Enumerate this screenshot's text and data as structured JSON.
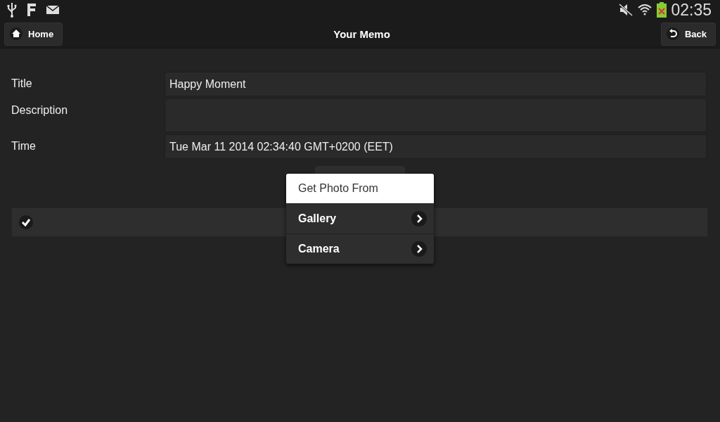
{
  "status_bar": {
    "time": "02:35"
  },
  "header": {
    "title": "Your Memo",
    "left_button": "Home",
    "right_button": "Back"
  },
  "form": [
    {
      "label": "Title",
      "value": "Happy Moment",
      "kind": "line"
    },
    {
      "label": "Description",
      "kind": "area"
    },
    {
      "label": "Time",
      "value": "Tue Mar 11 2014 02:34:40 GMT+0200 (EET)",
      "kind": "line"
    }
  ],
  "popup_menu": {
    "title": "Get Photo From",
    "items": [
      {
        "label": "Gallery"
      },
      {
        "label": "Camera"
      }
    ]
  }
}
